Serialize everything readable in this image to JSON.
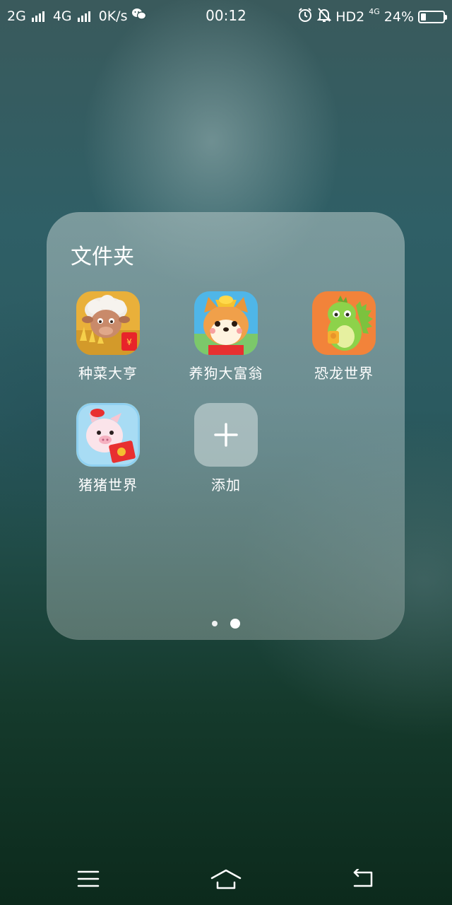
{
  "status_bar": {
    "sim1": "2G",
    "sim2": "4G",
    "speed": "0K/s",
    "time": "00:12",
    "network": "HD2",
    "network_small": "4G",
    "battery_text": "24%",
    "battery_level": 0.24,
    "icons": [
      "signal-icon",
      "wechat-icon",
      "alarm-icon",
      "mute-bell-icon",
      "battery-icon"
    ]
  },
  "folder": {
    "title": "文件夹",
    "apps": [
      {
        "label": "种菜大亨",
        "icon": "farm-sheep-app-icon"
      },
      {
        "label": "养狗大富翁",
        "icon": "shiba-dog-app-icon"
      },
      {
        "label": "恐龙世界",
        "icon": "dinosaur-app-icon"
      },
      {
        "label": "猪猪世界",
        "icon": "pig-app-icon"
      }
    ],
    "add_label": "添加",
    "pages": 2,
    "current_page": 2
  },
  "nav": {
    "icons": [
      "menu-icon",
      "home-icon",
      "back-icon"
    ]
  }
}
